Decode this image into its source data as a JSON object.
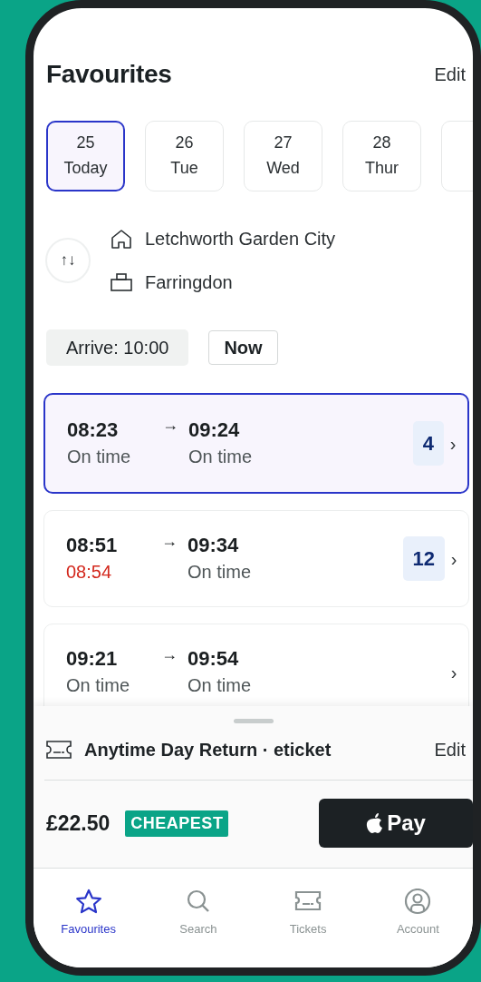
{
  "header": {
    "title": "Favourites",
    "edit": "Edit"
  },
  "dates": [
    {
      "day": "25",
      "label": "Today",
      "selected": true
    },
    {
      "day": "26",
      "label": "Tue",
      "selected": false
    },
    {
      "day": "27",
      "label": "Wed",
      "selected": false
    },
    {
      "day": "28",
      "label": "Thur",
      "selected": false
    }
  ],
  "route": {
    "from": "Letchworth Garden City",
    "to": "Farringdon",
    "swap": "↑↓"
  },
  "time_filters": [
    {
      "label": "Arrive: 10:00",
      "kind": "pill"
    },
    {
      "label": "Now",
      "kind": "button"
    }
  ],
  "journeys": [
    {
      "depart": "08:23",
      "depart_status": "On time",
      "depart_delayed": false,
      "arrow": "→",
      "arrive": "09:24",
      "arrive_status": "On time",
      "platform": "4",
      "chevron": "›",
      "selected": true
    },
    {
      "depart": "08:51",
      "depart_status": "08:54",
      "depart_delayed": true,
      "arrow": "→",
      "arrive": "09:34",
      "arrive_status": "On time",
      "platform": "12",
      "chevron": "›",
      "selected": false
    },
    {
      "depart": "09:21",
      "depart_status": "On time",
      "depart_delayed": false,
      "arrow": "→",
      "arrive": "09:54",
      "arrive_status": "On time",
      "chevron": "›",
      "selected": false
    }
  ],
  "ticket": {
    "name": "Anytime Day Return · eticket",
    "edit": "Edit",
    "price": "£22.50",
    "badge": "CHEAPEST",
    "pay_label": "Pay"
  },
  "tabs": [
    {
      "label": "Favourites",
      "kind": "star",
      "selected": true
    },
    {
      "label": "Search",
      "kind": "search",
      "selected": false
    },
    {
      "label": "Tickets",
      "kind": "ticket",
      "selected": false
    },
    {
      "label": "Account",
      "kind": "account",
      "selected": false
    }
  ]
}
